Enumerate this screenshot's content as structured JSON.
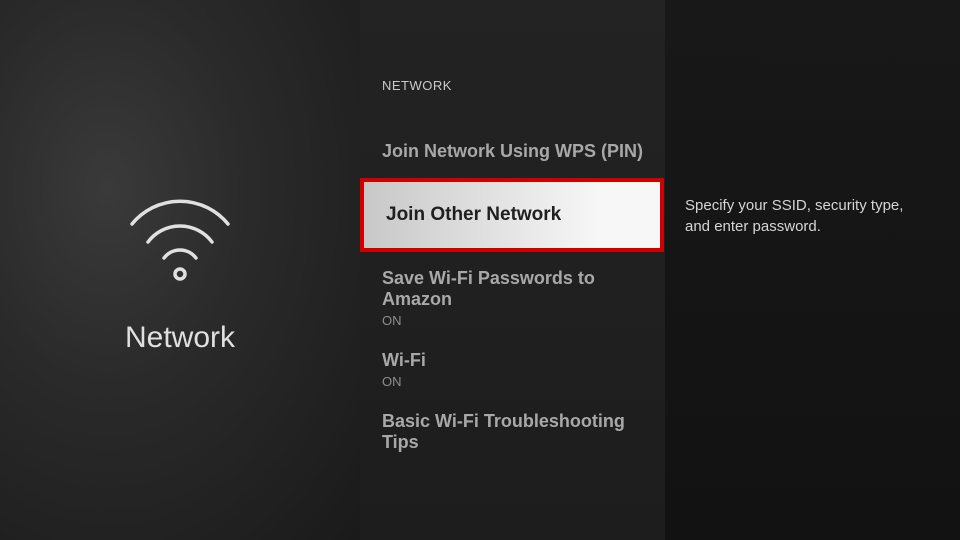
{
  "leftPanel": {
    "title": "Network"
  },
  "header": "NETWORK",
  "menu": {
    "items": [
      {
        "label": "Join Network Using WPS (PIN)",
        "status": ""
      },
      {
        "label": "Join Other Network",
        "status": ""
      },
      {
        "label": "Save Wi-Fi Passwords to Amazon",
        "status": "ON"
      },
      {
        "label": "Wi-Fi",
        "status": "ON"
      },
      {
        "label": "Basic Wi-Fi Troubleshooting Tips",
        "status": ""
      }
    ]
  },
  "description": "Specify your SSID, security type, and enter password."
}
